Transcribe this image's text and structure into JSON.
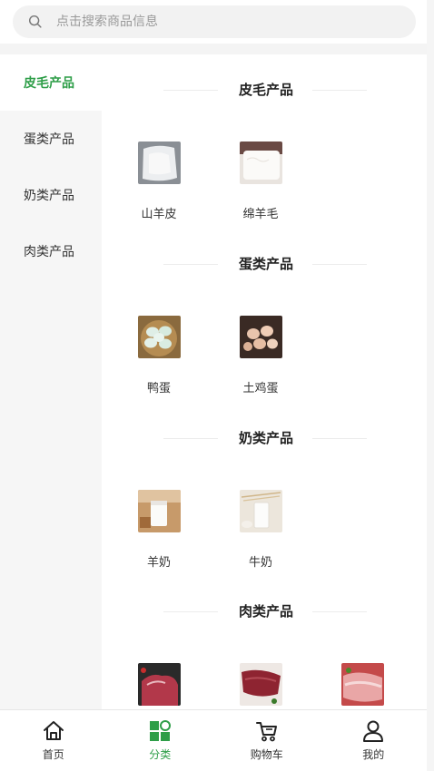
{
  "search": {
    "placeholder": "点击搜索商品信息"
  },
  "sidebar": {
    "items": [
      {
        "label": "皮毛产品",
        "active": true
      },
      {
        "label": "蛋类产品",
        "active": false
      },
      {
        "label": "奶类产品",
        "active": false
      },
      {
        "label": "肉类产品",
        "active": false
      }
    ]
  },
  "sections": [
    {
      "title": "皮毛产品",
      "products": [
        {
          "name": "山羊皮"
        },
        {
          "name": "绵羊毛"
        }
      ]
    },
    {
      "title": "蛋类产品",
      "products": [
        {
          "name": "鸭蛋"
        },
        {
          "name": "土鸡蛋"
        }
      ]
    },
    {
      "title": "奶类产品",
      "products": [
        {
          "name": "羊奶"
        },
        {
          "name": "牛奶"
        }
      ]
    },
    {
      "title": "肉类产品",
      "products": [
        {},
        {},
        {}
      ]
    }
  ],
  "tabbar": {
    "items": [
      {
        "label": "首页",
        "icon": "home-icon"
      },
      {
        "label": "分类",
        "icon": "category-icon",
        "active": true
      },
      {
        "label": "购物车",
        "icon": "cart-icon"
      },
      {
        "label": "我的",
        "icon": "user-icon"
      }
    ]
  },
  "colors": {
    "accent": "#2e9e48"
  }
}
